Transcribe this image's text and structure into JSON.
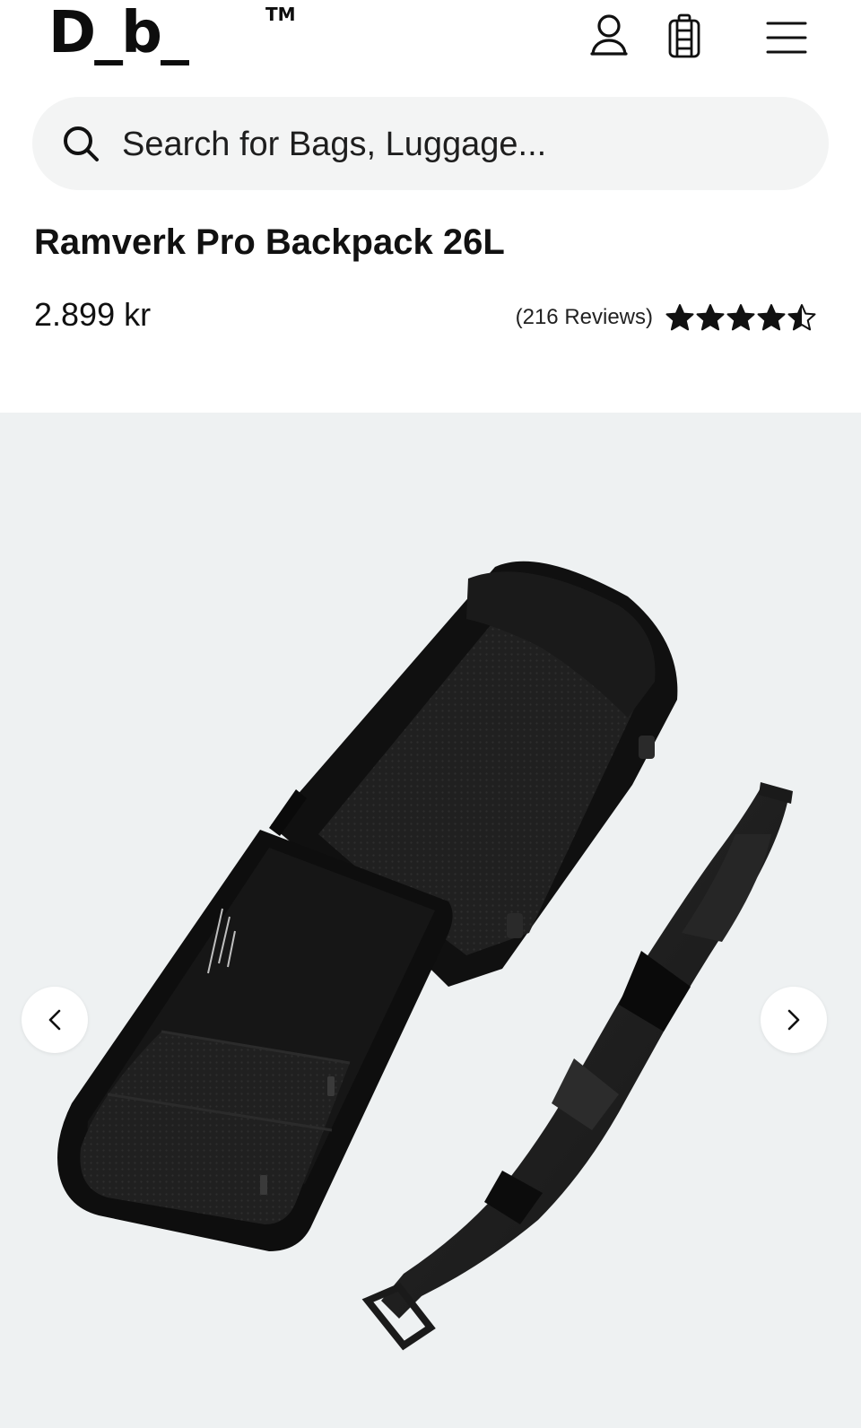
{
  "header": {
    "logo": "D_b_",
    "logo_tm": "TM",
    "icons": [
      "account-icon",
      "backpack-icon",
      "menu-icon"
    ]
  },
  "search": {
    "placeholder": "Search for Bags, Luggage..."
  },
  "product": {
    "title": "Ramverk Pro Backpack 26L",
    "price": "2.899 kr",
    "reviews_label": "(216 Reviews)",
    "rating": 4.5,
    "rating_max": 5
  },
  "gallery": {
    "background": "#eef1f2",
    "prev_icon": "chevron-left-icon",
    "next_icon": "chevron-right-icon"
  },
  "colors": {
    "text": "#111111",
    "search_bg": "#f3f4f4",
    "star": "#111111"
  }
}
